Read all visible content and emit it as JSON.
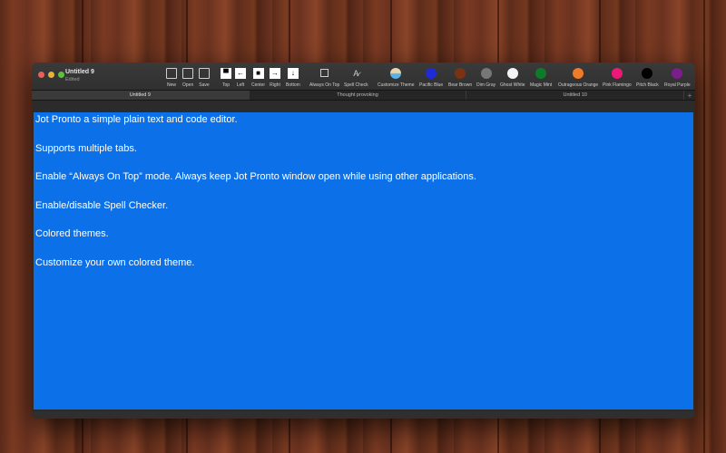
{
  "window": {
    "title": "Untitled 9",
    "subtitle": "Edited"
  },
  "toolbar": {
    "file": [
      {
        "label": "New",
        "icon": "new-document-icon"
      },
      {
        "label": "Open",
        "icon": "open-folder-icon"
      },
      {
        "label": "Save",
        "icon": "save-icon"
      }
    ],
    "positions": [
      {
        "label": "Top",
        "icon": "top-arrow-icon"
      },
      {
        "label": "Left",
        "icon": "left-arrow-icon"
      },
      {
        "label": "Center",
        "icon": "center-square-icon"
      },
      {
        "label": "Right",
        "icon": "right-arrow-icon"
      },
      {
        "label": "Bottom",
        "icon": "bottom-arrow-icon"
      }
    ],
    "toggles": [
      {
        "label": "Always On Top",
        "icon": "window-icon"
      },
      {
        "label": "Spell Check",
        "icon": "spell-check-icon"
      }
    ],
    "themes": [
      {
        "label": "Customize Theme",
        "color": "#d8c9a8"
      },
      {
        "label": "Pacific Blue",
        "color": "#1f2bd6"
      },
      {
        "label": "Bear Brown",
        "color": "#7a3312"
      },
      {
        "label": "Dim Gray",
        "color": "#777777"
      },
      {
        "label": "Ghost White",
        "color": "#f4f4f4"
      },
      {
        "label": "Magic Mint",
        "color": "#0f7a2a"
      },
      {
        "label": "Outrageous Orange",
        "color": "#f07a25"
      },
      {
        "label": "Pink Flamingo",
        "color": "#ee1877"
      },
      {
        "label": "Pitch Black",
        "color": "#000000"
      },
      {
        "label": "Royal Purple",
        "color": "#7a1e8a"
      }
    ]
  },
  "tabs": [
    {
      "label": "Untitled 9",
      "active": true
    },
    {
      "label": "Thought provoking",
      "active": false
    },
    {
      "label": "Untitled 10",
      "active": false
    }
  ],
  "tab_add_label": "+",
  "editor": {
    "background": "#0c70e8",
    "lines": [
      "Jot Pronto a simple plain text and code editor.",
      "Supports multiple tabs.",
      "Enable “Always On Top” mode. Always keep Jot Pronto window open while using other applications.",
      "Enable/disable Spell Checker.",
      "Colored themes.",
      "Customize your own colored theme."
    ]
  }
}
